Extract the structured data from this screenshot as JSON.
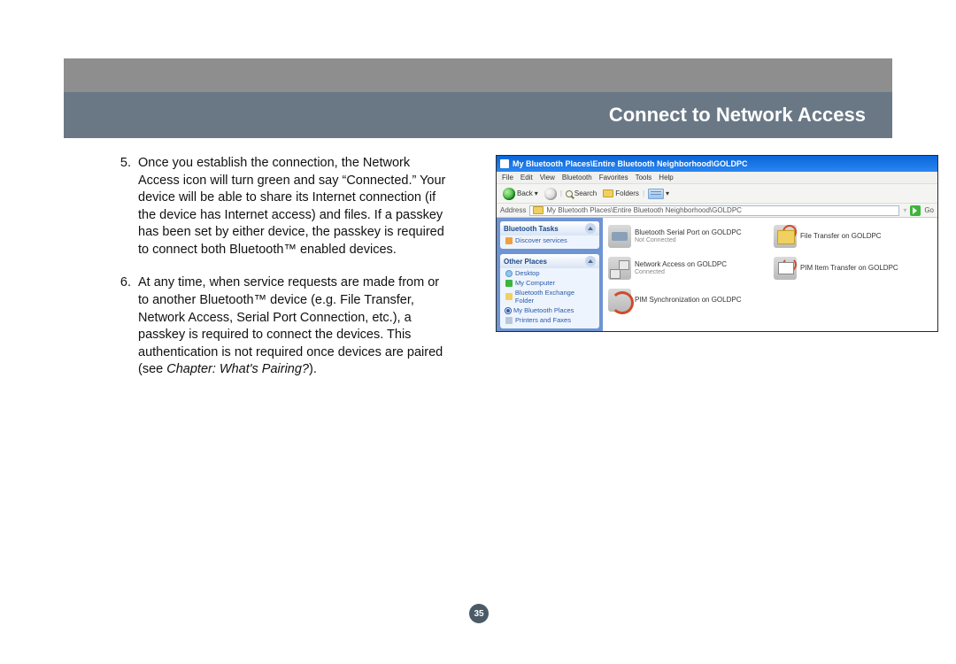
{
  "header": {
    "title": "Connect to Network Access"
  },
  "page_number": "35",
  "steps": [
    {
      "n": "5.",
      "text": "Once you establish the connection, the Network Access icon will turn green and say “Connected.” Your device will be able to share its Internet connection (if the device has Internet access) and files. If a passkey has been set by either device, the passkey is required to connect both Bluetooth™ enabled devices."
    },
    {
      "n": "6.",
      "text_a": "At any time, when service requests are made from or to another Bluetooth™ device (e.g. File Transfer, Network Access, Serial Port Connection, etc.), a passkey is required to connect the devices. This authentication is not required once devices are paired (see ",
      "text_i": "Chapter: What's Pairing?",
      "text_b": ")."
    }
  ],
  "window": {
    "title": "My Bluetooth Places\\Entire Bluetooth Neighborhood\\GOLDPC",
    "menus": [
      "File",
      "Edit",
      "View",
      "Bluetooth",
      "Favorites",
      "Tools",
      "Help"
    ],
    "toolbar": {
      "back": "Back",
      "search": "Search",
      "folders": "Folders"
    },
    "address_label": "Address",
    "address_value": "My Bluetooth Places\\Entire Bluetooth Neighborhood\\GOLDPC",
    "go": "Go",
    "side": {
      "tasks_head": "Bluetooth Tasks",
      "tasks": [
        "Discover services"
      ],
      "places_head": "Other Places",
      "places": [
        "Desktop",
        "My Computer",
        "Bluetooth Exchange Folder",
        "My Bluetooth Places",
        "Printers and Faxes"
      ]
    },
    "services": [
      {
        "label": "Bluetooth Serial Port on GOLDPC",
        "sub": "Not Connected"
      },
      {
        "label": "File Transfer on GOLDPC",
        "sub": ""
      },
      {
        "label": "Network Access on GOLDPC",
        "sub": "Connected"
      },
      {
        "label": "PIM Item Transfer on GOLDPC",
        "sub": ""
      },
      {
        "label": "PIM Synchronization on GOLDPC",
        "sub": ""
      }
    ]
  }
}
